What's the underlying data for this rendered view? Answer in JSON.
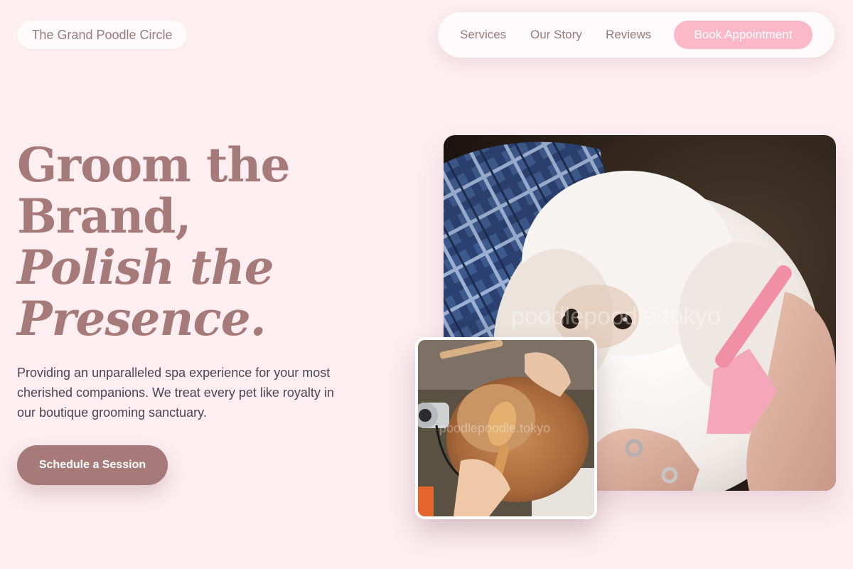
{
  "brand": {
    "name": "The Grand Poodle Circle"
  },
  "nav": {
    "links": [
      "Services",
      "Our Story",
      "Reviews"
    ],
    "book_label": "Book Appointment"
  },
  "hero": {
    "headline_line1": "Groom the",
    "headline_line2": "Brand,",
    "headline_line3": "Polish the",
    "headline_line4": "Presence.",
    "lead": "Providing an unparalleled spa experience for your most cherished companions. We treat every pet like royalty in our boutique grooming sanctuary.",
    "cta_label": "Schedule a Session"
  },
  "images": {
    "main_watermark": "poodlepoodle.tokyo",
    "inset_watermark": "poodlepoodle.tokyo"
  },
  "colors": {
    "background": "#fdeef2",
    "accent": "#a67a79",
    "button_pink": "#fbb8c8",
    "text_dark": "#4a4553"
  }
}
